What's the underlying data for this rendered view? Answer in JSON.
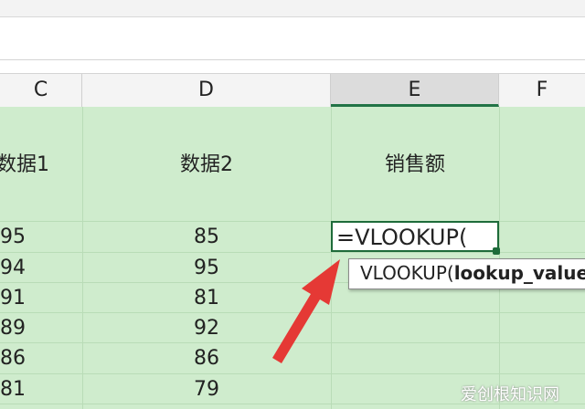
{
  "columns": {
    "c": "C",
    "d": "D",
    "e": "E",
    "f": "F"
  },
  "headers": {
    "c": "数据1",
    "d": "数据2",
    "e": "销售额"
  },
  "rows": [
    {
      "c": "95",
      "d": "85"
    },
    {
      "c": "94",
      "d": "95"
    },
    {
      "c": "91",
      "d": "81"
    },
    {
      "c": "89",
      "d": "92"
    },
    {
      "c": "86",
      "d": "86"
    },
    {
      "c": "81",
      "d": "79"
    }
  ],
  "active_cell": {
    "formula": "=VLOOKUP("
  },
  "tooltip": {
    "function_name": "VLOOKUP(",
    "arg": "lookup_value"
  },
  "watermark": "爱创根知识网",
  "colors": {
    "grid_fill": "#cfeccd",
    "active_border": "#1e6b3a",
    "arrow": "#e53935"
  }
}
